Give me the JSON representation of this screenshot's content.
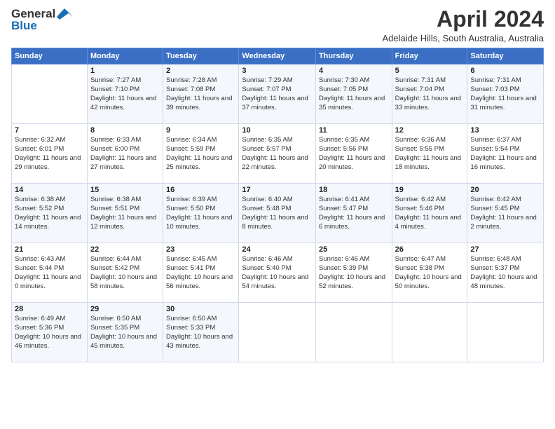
{
  "logo": {
    "general": "General",
    "blue": "Blue"
  },
  "title": "April 2024",
  "subtitle": "Adelaide Hills, South Australia, Australia",
  "days_of_week": [
    "Sunday",
    "Monday",
    "Tuesday",
    "Wednesday",
    "Thursday",
    "Friday",
    "Saturday"
  ],
  "weeks": [
    [
      {
        "day": "",
        "sunrise": "",
        "sunset": "",
        "daylight": ""
      },
      {
        "day": "1",
        "sunrise": "Sunrise: 7:27 AM",
        "sunset": "Sunset: 7:10 PM",
        "daylight": "Daylight: 11 hours and 42 minutes."
      },
      {
        "day": "2",
        "sunrise": "Sunrise: 7:28 AM",
        "sunset": "Sunset: 7:08 PM",
        "daylight": "Daylight: 11 hours and 39 minutes."
      },
      {
        "day": "3",
        "sunrise": "Sunrise: 7:29 AM",
        "sunset": "Sunset: 7:07 PM",
        "daylight": "Daylight: 11 hours and 37 minutes."
      },
      {
        "day": "4",
        "sunrise": "Sunrise: 7:30 AM",
        "sunset": "Sunset: 7:05 PM",
        "daylight": "Daylight: 11 hours and 35 minutes."
      },
      {
        "day": "5",
        "sunrise": "Sunrise: 7:31 AM",
        "sunset": "Sunset: 7:04 PM",
        "daylight": "Daylight: 11 hours and 33 minutes."
      },
      {
        "day": "6",
        "sunrise": "Sunrise: 7:31 AM",
        "sunset": "Sunset: 7:03 PM",
        "daylight": "Daylight: 11 hours and 31 minutes."
      }
    ],
    [
      {
        "day": "7",
        "sunrise": "Sunrise: 6:32 AM",
        "sunset": "Sunset: 6:01 PM",
        "daylight": "Daylight: 11 hours and 29 minutes."
      },
      {
        "day": "8",
        "sunrise": "Sunrise: 6:33 AM",
        "sunset": "Sunset: 6:00 PM",
        "daylight": "Daylight: 11 hours and 27 minutes."
      },
      {
        "day": "9",
        "sunrise": "Sunrise: 6:34 AM",
        "sunset": "Sunset: 5:59 PM",
        "daylight": "Daylight: 11 hours and 25 minutes."
      },
      {
        "day": "10",
        "sunrise": "Sunrise: 6:35 AM",
        "sunset": "Sunset: 5:57 PM",
        "daylight": "Daylight: 11 hours and 22 minutes."
      },
      {
        "day": "11",
        "sunrise": "Sunrise: 6:35 AM",
        "sunset": "Sunset: 5:56 PM",
        "daylight": "Daylight: 11 hours and 20 minutes."
      },
      {
        "day": "12",
        "sunrise": "Sunrise: 6:36 AM",
        "sunset": "Sunset: 5:55 PM",
        "daylight": "Daylight: 11 hours and 18 minutes."
      },
      {
        "day": "13",
        "sunrise": "Sunrise: 6:37 AM",
        "sunset": "Sunset: 5:54 PM",
        "daylight": "Daylight: 11 hours and 16 minutes."
      }
    ],
    [
      {
        "day": "14",
        "sunrise": "Sunrise: 6:38 AM",
        "sunset": "Sunset: 5:52 PM",
        "daylight": "Daylight: 11 hours and 14 minutes."
      },
      {
        "day": "15",
        "sunrise": "Sunrise: 6:38 AM",
        "sunset": "Sunset: 5:51 PM",
        "daylight": "Daylight: 11 hours and 12 minutes."
      },
      {
        "day": "16",
        "sunrise": "Sunrise: 6:39 AM",
        "sunset": "Sunset: 5:50 PM",
        "daylight": "Daylight: 11 hours and 10 minutes."
      },
      {
        "day": "17",
        "sunrise": "Sunrise: 6:40 AM",
        "sunset": "Sunset: 5:48 PM",
        "daylight": "Daylight: 11 hours and 8 minutes."
      },
      {
        "day": "18",
        "sunrise": "Sunrise: 6:41 AM",
        "sunset": "Sunset: 5:47 PM",
        "daylight": "Daylight: 11 hours and 6 minutes."
      },
      {
        "day": "19",
        "sunrise": "Sunrise: 6:42 AM",
        "sunset": "Sunset: 5:46 PM",
        "daylight": "Daylight: 11 hours and 4 minutes."
      },
      {
        "day": "20",
        "sunrise": "Sunrise: 6:42 AM",
        "sunset": "Sunset: 5:45 PM",
        "daylight": "Daylight: 11 hours and 2 minutes."
      }
    ],
    [
      {
        "day": "21",
        "sunrise": "Sunrise: 6:43 AM",
        "sunset": "Sunset: 5:44 PM",
        "daylight": "Daylight: 11 hours and 0 minutes."
      },
      {
        "day": "22",
        "sunrise": "Sunrise: 6:44 AM",
        "sunset": "Sunset: 5:42 PM",
        "daylight": "Daylight: 10 hours and 58 minutes."
      },
      {
        "day": "23",
        "sunrise": "Sunrise: 6:45 AM",
        "sunset": "Sunset: 5:41 PM",
        "daylight": "Daylight: 10 hours and 56 minutes."
      },
      {
        "day": "24",
        "sunrise": "Sunrise: 6:46 AM",
        "sunset": "Sunset: 5:40 PM",
        "daylight": "Daylight: 10 hours and 54 minutes."
      },
      {
        "day": "25",
        "sunrise": "Sunrise: 6:46 AM",
        "sunset": "Sunset: 5:39 PM",
        "daylight": "Daylight: 10 hours and 52 minutes."
      },
      {
        "day": "26",
        "sunrise": "Sunrise: 6:47 AM",
        "sunset": "Sunset: 5:38 PM",
        "daylight": "Daylight: 10 hours and 50 minutes."
      },
      {
        "day": "27",
        "sunrise": "Sunrise: 6:48 AM",
        "sunset": "Sunset: 5:37 PM",
        "daylight": "Daylight: 10 hours and 48 minutes."
      }
    ],
    [
      {
        "day": "28",
        "sunrise": "Sunrise: 6:49 AM",
        "sunset": "Sunset: 5:36 PM",
        "daylight": "Daylight: 10 hours and 46 minutes."
      },
      {
        "day": "29",
        "sunrise": "Sunrise: 6:50 AM",
        "sunset": "Sunset: 5:35 PM",
        "daylight": "Daylight: 10 hours and 45 minutes."
      },
      {
        "day": "30",
        "sunrise": "Sunrise: 6:50 AM",
        "sunset": "Sunset: 5:33 PM",
        "daylight": "Daylight: 10 hours and 43 minutes."
      },
      {
        "day": "",
        "sunrise": "",
        "sunset": "",
        "daylight": ""
      },
      {
        "day": "",
        "sunrise": "",
        "sunset": "",
        "daylight": ""
      },
      {
        "day": "",
        "sunrise": "",
        "sunset": "",
        "daylight": ""
      },
      {
        "day": "",
        "sunrise": "",
        "sunset": "",
        "daylight": ""
      }
    ]
  ]
}
